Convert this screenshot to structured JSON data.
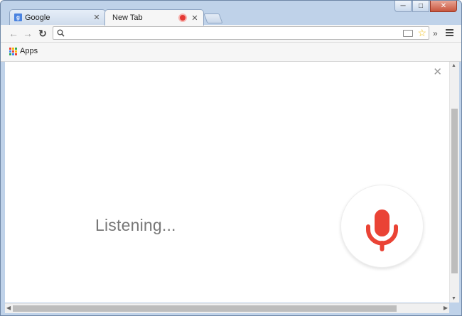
{
  "tabs": [
    {
      "title": "Google",
      "favicon": "google-g-icon",
      "state": "inactive"
    },
    {
      "title": "New Tab",
      "state": "active",
      "recording": true
    }
  ],
  "omnibox": {
    "value": "",
    "placeholder": ""
  },
  "bookmarks": [
    {
      "label": "Apps"
    }
  ],
  "content": {
    "status_text": "Listening..."
  },
  "colors": {
    "mic": "#ea4335",
    "recording_dot": "#e53935",
    "frame": "#bfd2e9"
  }
}
